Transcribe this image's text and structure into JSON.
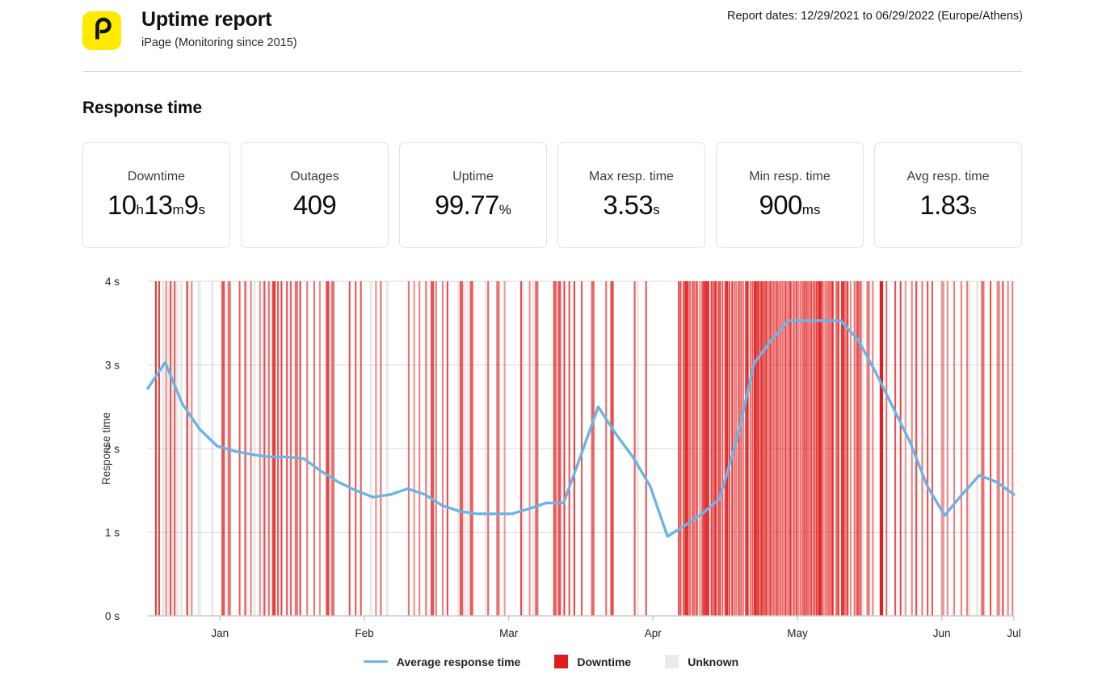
{
  "header": {
    "logo_letter": "p",
    "logo_color": "#FFEA00",
    "title": "Uptime report",
    "subtitle": "iPage (Monitoring since 2015)",
    "report_dates": "Report dates: 12/29/2021 to 06/29/2022 (Europe/Athens)"
  },
  "section": {
    "title": "Response time"
  },
  "cards": [
    {
      "label": "Downtime",
      "value": "10",
      "unit1": "h",
      "value2": "13",
      "unit2": "m",
      "value3": "9",
      "unit3": "s"
    },
    {
      "label": "Outages",
      "value": "409",
      "unit1": ""
    },
    {
      "label": "Uptime",
      "value": "99.77",
      "unit1": "%"
    },
    {
      "label": "Max resp. time",
      "value": "3.53",
      "unit1": "s"
    },
    {
      "label": "Min resp. time",
      "value": "900",
      "unit1": "ms"
    },
    {
      "label": "Avg resp. time",
      "value": "1.83",
      "unit1": "s"
    }
  ],
  "legend": [
    {
      "name": "average-response-time",
      "label": "Average response time",
      "type": "line",
      "color": "#6CB4E4"
    },
    {
      "name": "downtime",
      "label": "Downtime",
      "type": "swatch",
      "color": "#E01B1B"
    },
    {
      "name": "unknown",
      "label": "Unknown",
      "type": "swatch",
      "color": "#EAEAEA"
    }
  ],
  "chart_data": {
    "type": "line",
    "title": "Response time",
    "xlabel": "",
    "ylabel": "Response time",
    "ylim": [
      0,
      4
    ],
    "y_ticks": [
      0,
      1,
      2,
      3,
      4
    ],
    "y_tick_labels": [
      "0 s",
      "1 s",
      "2 s",
      "3 s",
      "4 s"
    ],
    "x_tick_labels": [
      "Jan",
      "Feb",
      "Mar",
      "Apr",
      "May",
      "Jun",
      "Jul"
    ],
    "x_tick_positions": [
      0.0833,
      0.25,
      0.4167,
      0.5833,
      0.75,
      0.9167,
      1.0
    ],
    "grid": true,
    "legend_position": "bottom",
    "series": [
      {
        "name": "Average response time",
        "color": "#6CB4E4",
        "unit": "s",
        "x": [
          0.0,
          0.02,
          0.04,
          0.06,
          0.08,
          0.1,
          0.12,
          0.14,
          0.16,
          0.18,
          0.2,
          0.22,
          0.24,
          0.26,
          0.28,
          0.3,
          0.32,
          0.34,
          0.36,
          0.38,
          0.4,
          0.42,
          0.44,
          0.46,
          0.48,
          0.5,
          0.52,
          0.54,
          0.56,
          0.58,
          0.6,
          0.62,
          0.64,
          0.66,
          0.68,
          0.7,
          0.72,
          0.74,
          0.76,
          0.78,
          0.8,
          0.82,
          0.84,
          0.86,
          0.88,
          0.9,
          0.92,
          0.94,
          0.96,
          0.98,
          1.0
        ],
        "values": [
          2.72,
          3.03,
          2.53,
          2.23,
          2.03,
          1.97,
          1.93,
          1.9,
          1.9,
          1.88,
          1.73,
          1.6,
          1.5,
          1.42,
          1.45,
          1.52,
          1.45,
          1.32,
          1.25,
          1.22,
          1.22,
          1.22,
          1.28,
          1.35,
          1.35,
          1.92,
          2.5,
          2.18,
          1.9,
          1.55,
          0.95,
          1.08,
          1.22,
          1.4,
          2.1,
          3.02,
          3.3,
          3.53,
          3.53,
          3.53,
          3.53,
          3.3,
          2.92,
          2.5,
          2.08,
          1.55,
          1.2,
          1.45,
          1.68,
          1.6,
          1.45
        ]
      }
    ],
    "downtime_bars": {
      "color": "#E01B1B",
      "description": "Vertical red bars spanning full plot height marking downtime incidents; dense cluster between Apr and early May",
      "count": 409
    },
    "unknown_bars": {
      "color": "#EAEAEA",
      "description": "Vertical light-grey bars marking unknown status periods, mostly in Jan and Feb"
    }
  }
}
